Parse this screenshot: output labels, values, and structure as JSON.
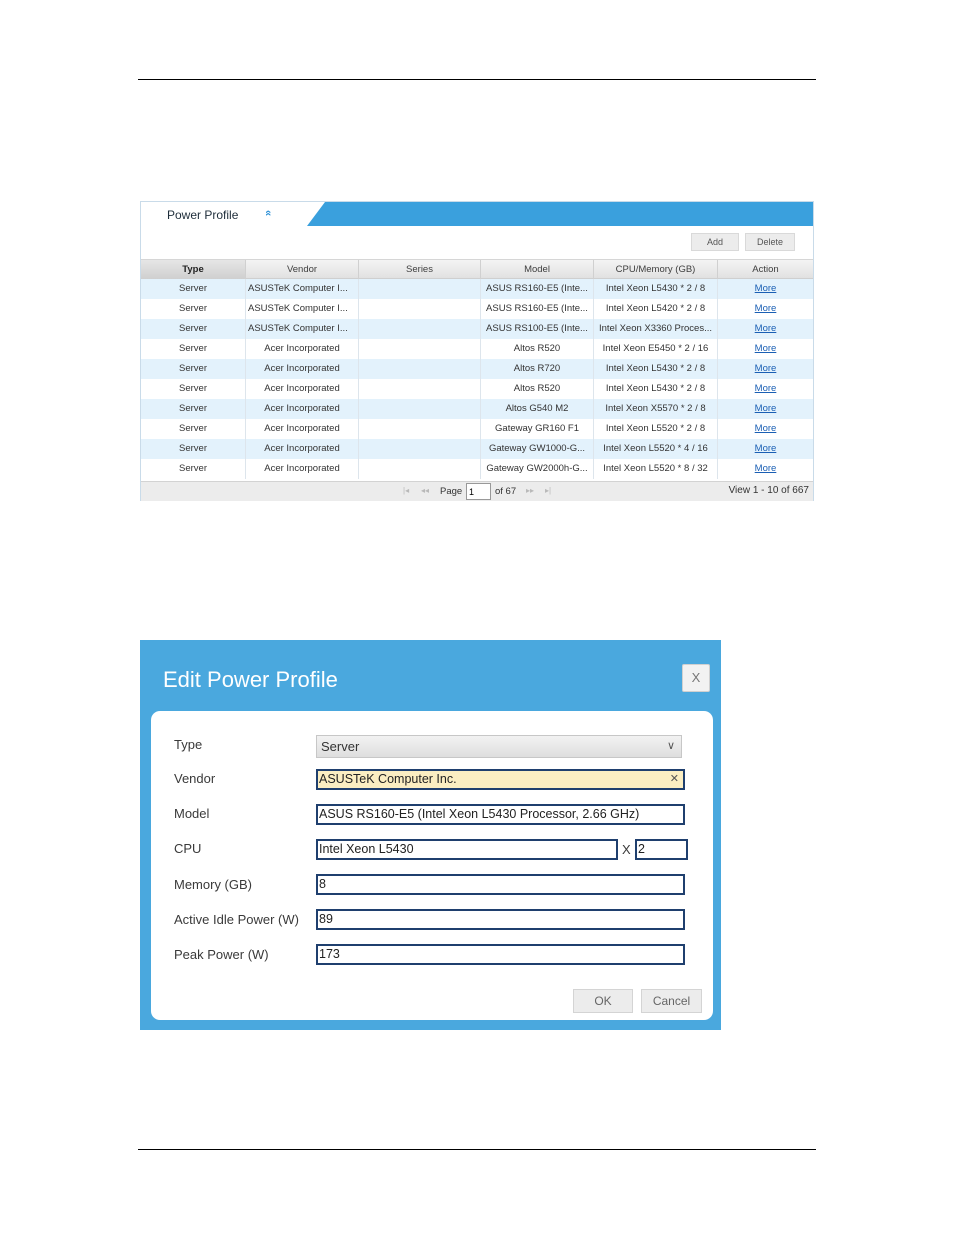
{
  "panel": {
    "title": "Power Profile",
    "collapse_icon": "«",
    "add_label": "Add",
    "delete_label": "Delete",
    "columns": [
      "Type",
      "Vendor",
      "Series",
      "Model",
      "CPU/Memory (GB)",
      "Action"
    ],
    "rows": [
      [
        "Server",
        "ASUSTeK Computer I...",
        "",
        "ASUS RS160-E5 (Inte...",
        "Intel Xeon L5430 * 2 / 8",
        "More"
      ],
      [
        "Server",
        "ASUSTeK Computer I...",
        "",
        "ASUS RS160-E5 (Inte...",
        "Intel Xeon L5420 * 2 / 8",
        "More"
      ],
      [
        "Server",
        "ASUSTeK Computer I...",
        "",
        "ASUS RS100-E5 (Inte...",
        "Intel Xeon X3360 Proces...",
        "More"
      ],
      [
        "Server",
        "Acer Incorporated",
        "",
        "Altos R520",
        "Intel Xeon E5450 * 2 / 16",
        "More"
      ],
      [
        "Server",
        "Acer Incorporated",
        "",
        "Altos R720",
        "Intel Xeon L5430 * 2 / 8",
        "More"
      ],
      [
        "Server",
        "Acer Incorporated",
        "",
        "Altos R520",
        "Intel Xeon L5430 * 2 / 8",
        "More"
      ],
      [
        "Server",
        "Acer Incorporated",
        "",
        "Altos G540 M2",
        "Intel Xeon X5570 * 2 / 8",
        "More"
      ],
      [
        "Server",
        "Acer Incorporated",
        "",
        "Gateway GR160 F1",
        "Intel Xeon L5520 * 2 / 8",
        "More"
      ],
      [
        "Server",
        "Acer Incorporated",
        "",
        "Gateway GW1000-G...",
        "Intel Xeon L5520 * 4 / 16",
        "More"
      ],
      [
        "Server",
        "Acer Incorporated",
        "",
        "Gateway GW2000h-G...",
        "Intel Xeon L5520 * 8 / 32",
        "More"
      ]
    ],
    "pager": {
      "page_label": "Page",
      "page_value": "1",
      "of_label": "of 67",
      "view_text": "View 1 - 10 of 667",
      "first_icon": "|◂",
      "prev_icon": "◂◂",
      "next_icon": "▸▸",
      "last_icon": "▸|"
    }
  },
  "dialog": {
    "title": "Edit Power Profile",
    "close_label": "X",
    "fields": {
      "type_label": "Type",
      "type_value": "Server",
      "vendor_label": "Vendor",
      "vendor_value": "ASUSTeK Computer Inc.",
      "model_label": "Model",
      "model_value": "ASUS RS160-E5 (Intel Xeon L5430 Processor, 2.66 GHz)",
      "cpu_label": "CPU",
      "cpu_value": "Intel Xeon L5430",
      "cpu_count_sep": "X",
      "cpu_count": "2",
      "memory_label": "Memory (GB)",
      "memory_value": "8",
      "idle_label": "Active Idle Power (W)",
      "idle_value": "89",
      "peak_label": "Peak Power (W)",
      "peak_value": "173"
    },
    "ok_label": "OK",
    "cancel_label": "Cancel"
  },
  "colors": {
    "accent": "#3aa0dd",
    "dialog_bg": "#4aa8de",
    "row_alt": "#e3f2fc",
    "link": "#1a5fb4",
    "vendor_highlight": "#fbeec2"
  }
}
